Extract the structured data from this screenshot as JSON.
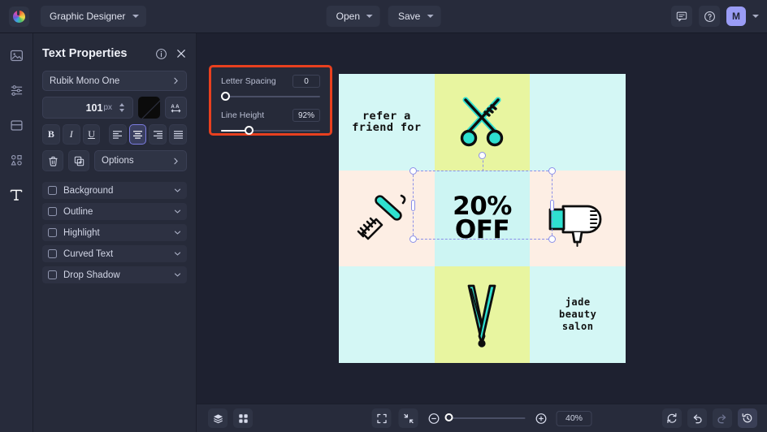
{
  "topbar": {
    "logo_icon": "color-wheel-logo",
    "document_name": "Graphic Designer",
    "open_label": "Open",
    "save_label": "Save",
    "comment_icon": "comment-icon",
    "help_icon": "help-icon",
    "avatar_initial": "M",
    "accent_avatar": "#9a9cf5"
  },
  "rail": {
    "items": [
      {
        "icon": "image-icon",
        "name": "images"
      },
      {
        "icon": "adjustments-icon",
        "name": "adjustments"
      },
      {
        "icon": "layout-icon",
        "name": "layout"
      },
      {
        "icon": "shapes-icon",
        "name": "shapes"
      },
      {
        "icon": "text-icon",
        "name": "text",
        "active": true
      }
    ]
  },
  "panel": {
    "title": "Text Properties",
    "info_icon": "info-icon",
    "close_icon": "close-icon",
    "font_family": "Rubik Mono One",
    "font_size": "101",
    "font_size_unit": "px",
    "color_swatch": "#0b0b0b",
    "letter_case_icon": "text-size-icon",
    "format_buttons": [
      {
        "label": "B",
        "name": "bold",
        "selected": false
      },
      {
        "label": "I",
        "name": "italic",
        "selected": false
      },
      {
        "label": "U",
        "name": "underline",
        "selected": false
      }
    ],
    "align_buttons": [
      {
        "icon": "align-left-icon",
        "selected": false
      },
      {
        "icon": "align-center-icon",
        "selected": true
      },
      {
        "icon": "align-right-icon",
        "selected": false
      },
      {
        "icon": "align-justify-icon",
        "selected": false
      }
    ],
    "delete_icon": "trash-icon",
    "duplicate_icon": "duplicate-icon",
    "options_label": "Options",
    "accordions": [
      {
        "label": "Background",
        "checked": false
      },
      {
        "label": "Outline",
        "checked": false
      },
      {
        "label": "Highlight",
        "checked": false
      },
      {
        "label": "Curved Text",
        "checked": false
      },
      {
        "label": "Drop Shadow",
        "checked": false
      }
    ]
  },
  "popup": {
    "highlight_color": "#e8401f",
    "letter_spacing_label": "Letter Spacing",
    "letter_spacing_value": "0",
    "letter_spacing_percent": 0,
    "line_height_label": "Line Height",
    "line_height_value": "92%",
    "line_height_percent": 28
  },
  "canvas": {
    "cells": [
      {
        "bg": "#d4f7f5",
        "text": "refer a\nfriend for",
        "art": null
      },
      {
        "bg": "#e8f5a0",
        "text": null,
        "art": "scissors"
      },
      {
        "bg": "#d4f7f5",
        "text": null,
        "art": null
      },
      {
        "bg": "#fdeee4",
        "text": null,
        "art": "comb-razor"
      },
      {
        "bg": "#cdf5f3",
        "text": "20%\nOFF",
        "art": null
      },
      {
        "bg": "#fdeee4",
        "text": null,
        "art": "hair-dryer"
      },
      {
        "bg": "#d4f7f5",
        "text": null,
        "art": null
      },
      {
        "bg": "#e8f5a0",
        "text": null,
        "art": "flat-iron"
      },
      {
        "bg": "#d4f7f5",
        "text": "jade\nbeauty\nsalon",
        "art": null
      }
    ],
    "selected_element": "20% OFF",
    "selection_color": "#8b8fe8",
    "teal": "#2ee0d0"
  },
  "bottombar": {
    "layers_icon": "layers-icon",
    "grid_icon": "grid-icon",
    "fit_icon": "fit-screen-icon",
    "collapse_icon": "collapse-icon",
    "zoom_out_icon": "zoom-out-icon",
    "zoom_in_icon": "zoom-in-icon",
    "zoom_value": "40%",
    "zoom_percent": 0,
    "reset_icon": "reset-icon",
    "undo_icon": "undo-icon",
    "redo_icon": "redo-icon",
    "history_icon": "history-icon"
  }
}
